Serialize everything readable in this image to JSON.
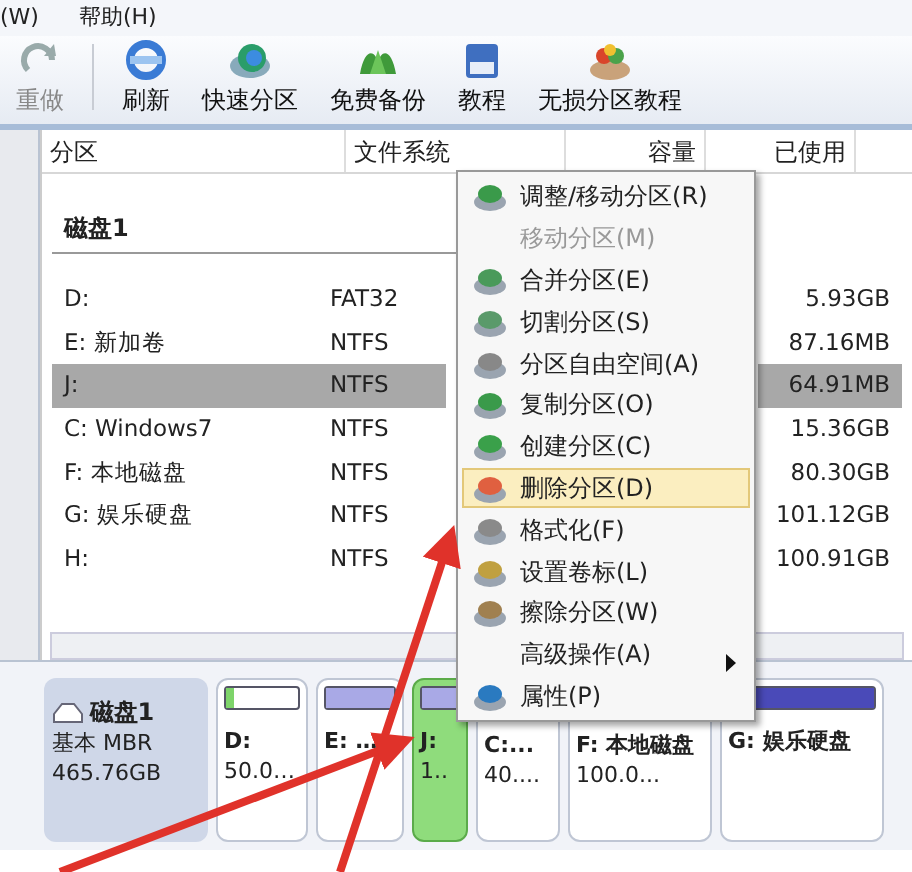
{
  "menubar": [
    "(W)",
    "帮助(H)"
  ],
  "toolbar": [
    {
      "label": "重做",
      "disabled": true
    },
    {
      "label": "刷新",
      "disabled": false
    },
    {
      "label": "快速分区",
      "disabled": false
    },
    {
      "label": "免费备份",
      "disabled": false
    },
    {
      "label": "教程",
      "disabled": false
    },
    {
      "label": "无损分区教程",
      "disabled": false
    }
  ],
  "table": {
    "columns": [
      "分区",
      "文件系统",
      "容量",
      "已使用"
    ],
    "disk_title": "磁盘1",
    "rows": [
      {
        "partition": "D:",
        "file_system": "FAT32",
        "used": "5.93GB",
        "selected": false
      },
      {
        "partition": "E: 新加卷",
        "file_system": "NTFS",
        "used": "87.16MB",
        "selected": false
      },
      {
        "partition": "J:",
        "file_system": "NTFS",
        "used": "64.91MB",
        "selected": true
      },
      {
        "partition": "C: Windows7",
        "file_system": "NTFS",
        "used": "15.36GB",
        "selected": false
      },
      {
        "partition": "F: 本地磁盘",
        "file_system": "NTFS",
        "used": "80.30GB",
        "selected": false
      },
      {
        "partition": "G: 娱乐硬盘",
        "file_system": "NTFS",
        "used": "101.12GB",
        "selected": false
      },
      {
        "partition": "H:",
        "file_system": "NTFS",
        "used": "100.91GB",
        "selected": false
      }
    ]
  },
  "context_menu": [
    {
      "label": "调整/移动分区(R)",
      "disabled": false,
      "highlighted": false,
      "has_icon": true,
      "submenu": false
    },
    {
      "label": "移动分区(M)",
      "disabled": true,
      "highlighted": false,
      "has_icon": false,
      "submenu": false
    },
    {
      "label": "合并分区(E)",
      "disabled": false,
      "highlighted": false,
      "has_icon": true,
      "submenu": false
    },
    {
      "label": "切割分区(S)",
      "disabled": false,
      "highlighted": false,
      "has_icon": true,
      "submenu": false
    },
    {
      "label": "分区自由空间(A)",
      "disabled": false,
      "highlighted": false,
      "has_icon": true,
      "submenu": false
    },
    {
      "label": "复制分区(O)",
      "disabled": false,
      "highlighted": false,
      "has_icon": true,
      "submenu": false
    },
    {
      "label": "创建分区(C)",
      "disabled": false,
      "highlighted": false,
      "has_icon": true,
      "submenu": false
    },
    {
      "label": "删除分区(D)",
      "disabled": false,
      "highlighted": true,
      "has_icon": true,
      "submenu": false
    },
    {
      "label": "格式化(F)",
      "disabled": false,
      "highlighted": false,
      "has_icon": true,
      "submenu": false
    },
    {
      "label": "设置卷标(L)",
      "disabled": false,
      "highlighted": false,
      "has_icon": true,
      "submenu": false
    },
    {
      "label": "擦除分区(W)",
      "disabled": false,
      "highlighted": false,
      "has_icon": true,
      "submenu": false
    },
    {
      "label": "高级操作(A)",
      "disabled": false,
      "highlighted": false,
      "has_icon": false,
      "submenu": true
    },
    {
      "label": "属性(P)",
      "disabled": false,
      "highlighted": false,
      "has_icon": true,
      "submenu": false
    }
  ],
  "disk_map": {
    "disk": {
      "name": "磁盘1",
      "type": "基本 MBR",
      "size": "465.76GB"
    },
    "partitions": [
      {
        "label": "D:",
        "size": "50.0…",
        "color": "#7ed46a",
        "level": 0.1,
        "selected": false
      },
      {
        "label": "E: …",
        "color": "#a9a9e6",
        "level": 1,
        "selected": false
      },
      {
        "label": "J:",
        "size": "1..",
        "color": "#a9a9e6",
        "level": 1,
        "selected": true
      },
      {
        "label": "C:...",
        "size": "40....",
        "selected": false
      },
      {
        "label": "F: 本地磁盘",
        "size": "100.0...",
        "selected": false
      },
      {
        "label": "G: 娱乐硬盘",
        "color": "#4a4ab8",
        "level": 1,
        "selected": false
      }
    ]
  }
}
